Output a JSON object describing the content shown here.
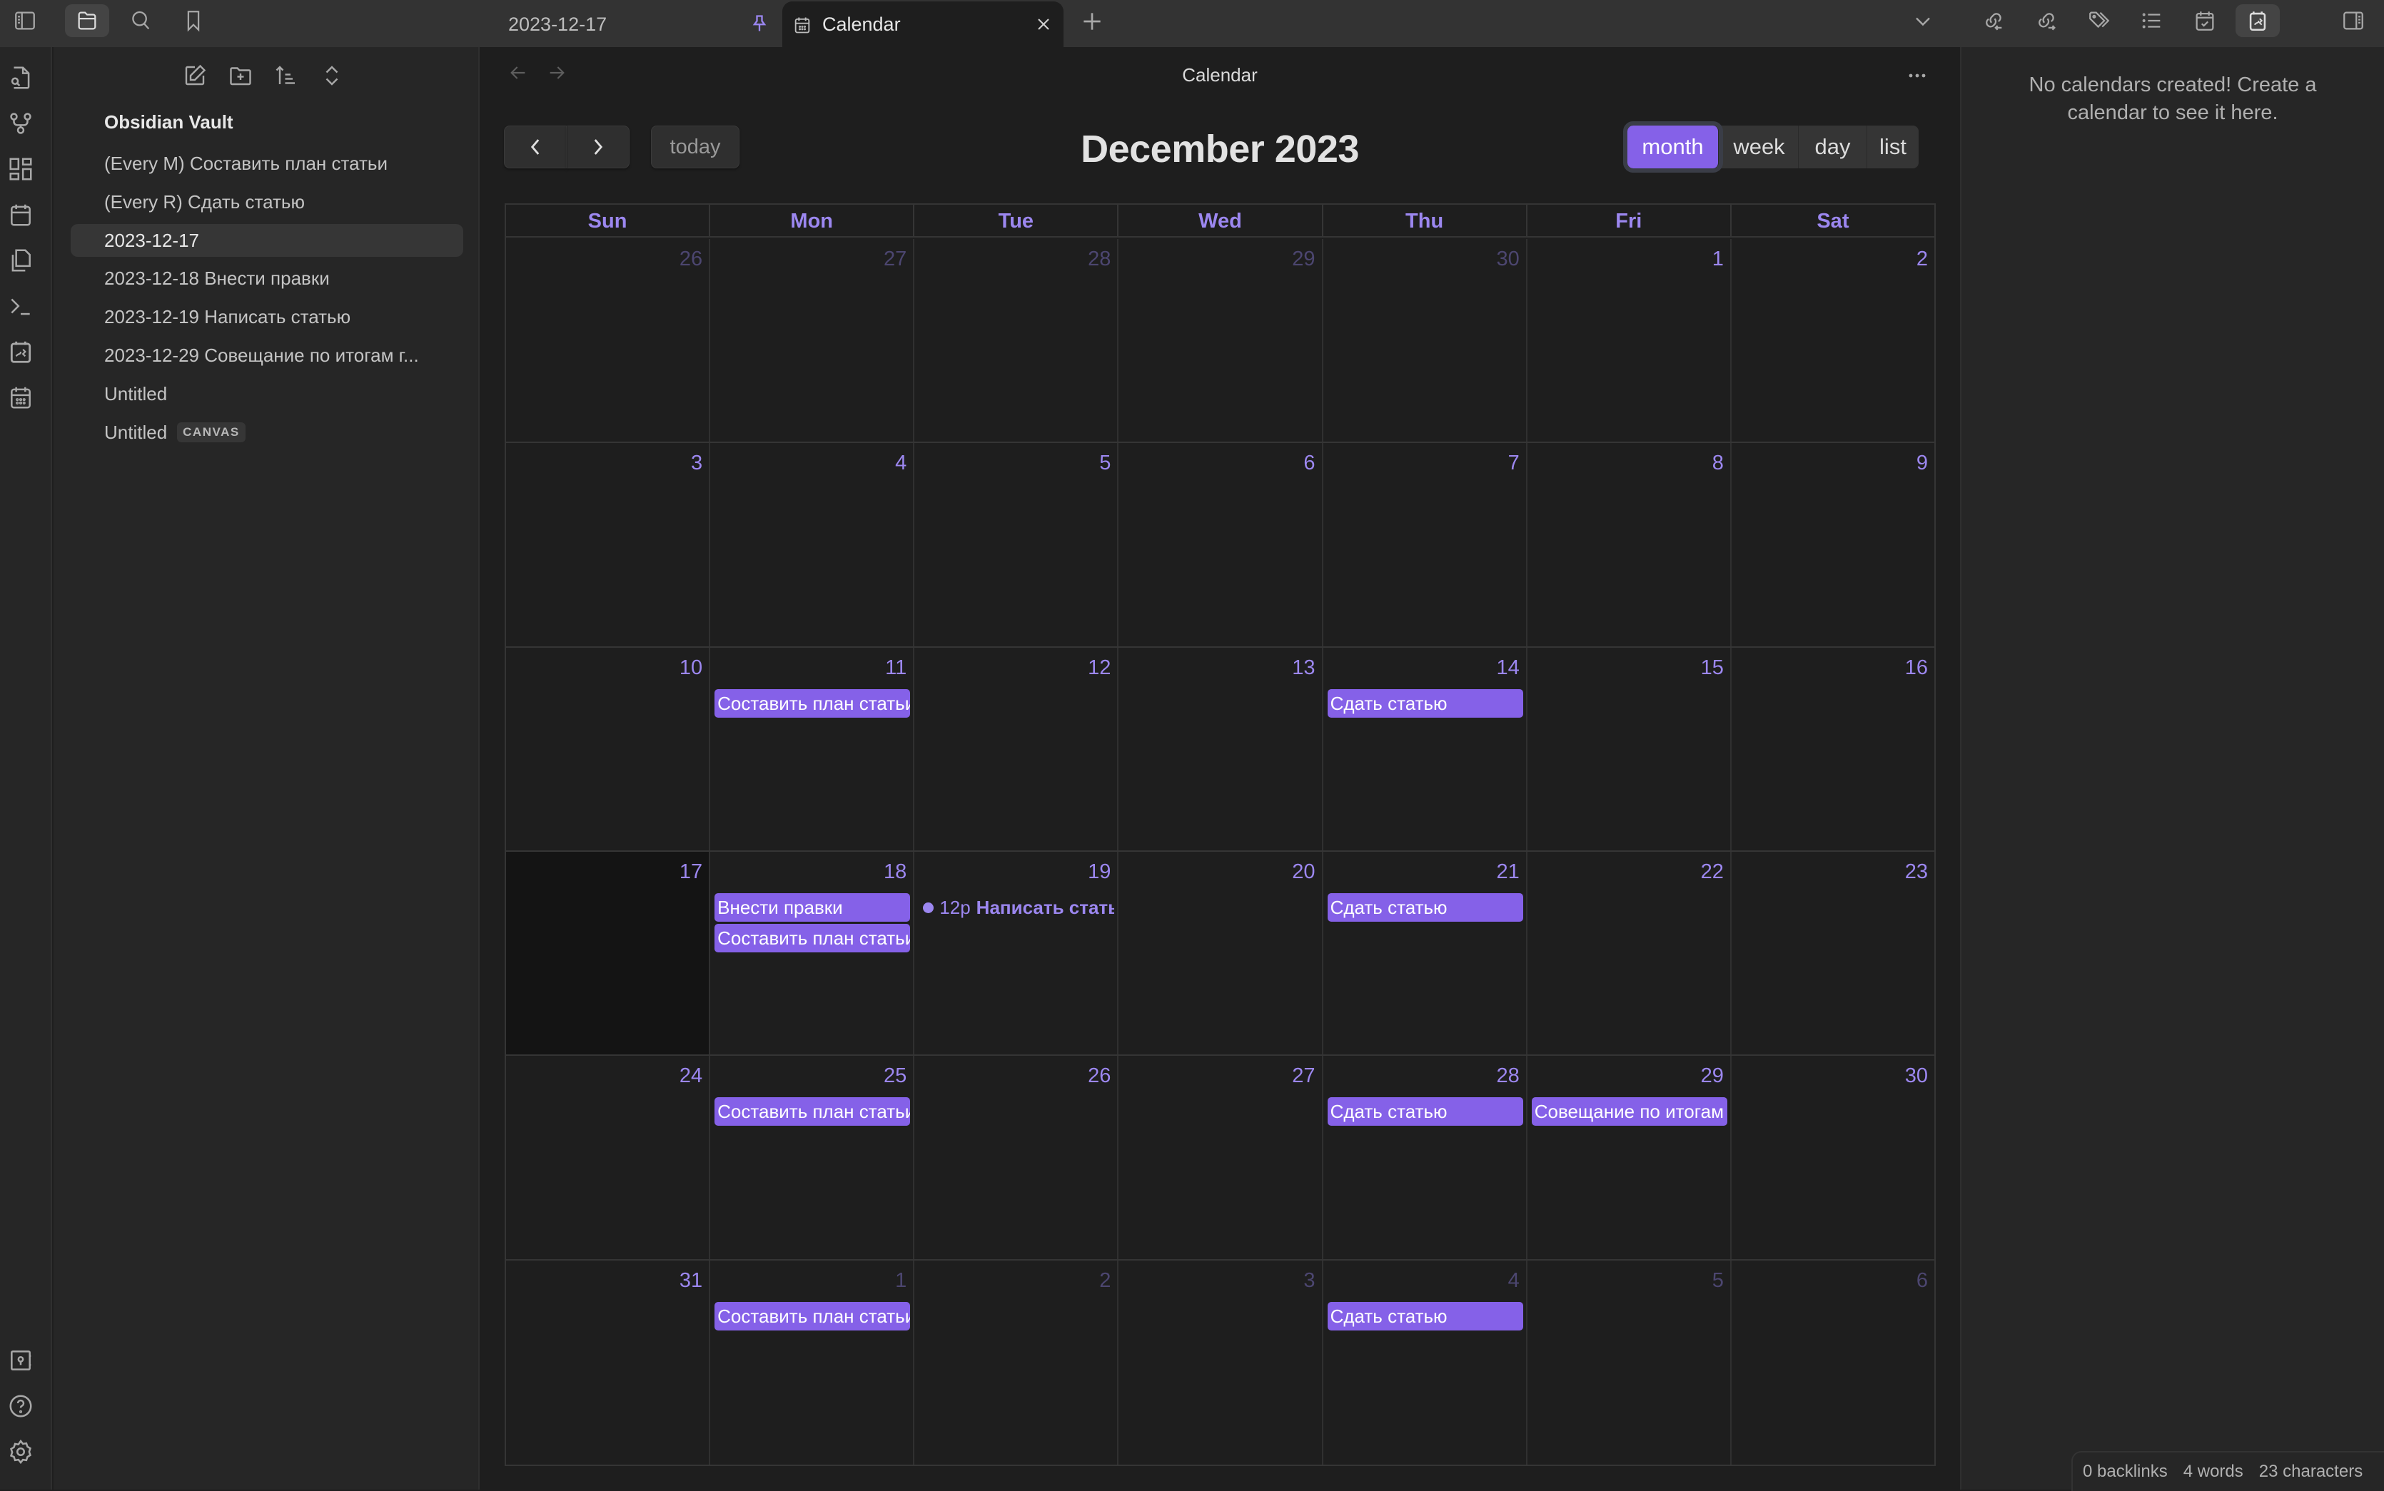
{
  "titlebar": {
    "left_icons": [
      {
        "name": "sidebar-left-toggle-icon"
      },
      {
        "name": "files-icon",
        "active": true
      },
      {
        "name": "search-icon"
      },
      {
        "name": "bookmark-icon"
      }
    ],
    "tabs": [
      {
        "title": "2023-12-17",
        "pinned": true,
        "active": false
      },
      {
        "title": "Calendar",
        "icon": "calendar-icon",
        "active": true
      }
    ],
    "right_icons": [
      {
        "name": "backlinks-icon"
      },
      {
        "name": "outgoing-links-icon"
      },
      {
        "name": "tags-icon"
      },
      {
        "name": "outline-icon"
      },
      {
        "name": "calendar-check-icon"
      },
      {
        "name": "full-calendar-icon",
        "active": true
      },
      {
        "name": "sidebar-right-toggle-icon"
      }
    ]
  },
  "ribbon": {
    "top": [
      "file-search-icon",
      "graph-icon",
      "dashboard-icon",
      "calendar-icon",
      "copy-icon",
      "terminal-icon",
      "full-calendar-icon",
      "calendar-grid-icon"
    ],
    "bottom": [
      "vault-icon",
      "help-icon",
      "settings-icon"
    ]
  },
  "explorer": {
    "vault": "Obsidian Vault",
    "files": [
      {
        "name": "(Every M) Составить план статьи"
      },
      {
        "name": "(Every R) Сдать статью"
      },
      {
        "name": "2023-12-17",
        "active": true
      },
      {
        "name": "2023-12-18 Внести правки"
      },
      {
        "name": "2023-12-19 Написать статью"
      },
      {
        "name": "2023-12-29 Совещание по итогам г..."
      },
      {
        "name": "Untitled"
      },
      {
        "name": "Untitled",
        "badge": "CANVAS"
      }
    ]
  },
  "main": {
    "view_title": "Calendar",
    "toolbar": {
      "prev": "‹",
      "next": "›",
      "today": "today",
      "title": "December 2023",
      "views": [
        {
          "label": "month",
          "active": true
        },
        {
          "label": "week"
        },
        {
          "label": "day"
        },
        {
          "label": "list"
        }
      ]
    },
    "weekdays": [
      "Sun",
      "Mon",
      "Tue",
      "Wed",
      "Thu",
      "Fri",
      "Sat"
    ],
    "weeks": [
      [
        {
          "day": "26",
          "other": true
        },
        {
          "day": "27",
          "other": true
        },
        {
          "day": "28",
          "other": true
        },
        {
          "day": "29",
          "other": true
        },
        {
          "day": "30",
          "other": true
        },
        {
          "day": "1"
        },
        {
          "day": "2"
        }
      ],
      [
        {
          "day": "3"
        },
        {
          "day": "4"
        },
        {
          "day": "5"
        },
        {
          "day": "6"
        },
        {
          "day": "7"
        },
        {
          "day": "8"
        },
        {
          "day": "9"
        }
      ],
      [
        {
          "day": "10"
        },
        {
          "day": "11",
          "events": [
            {
              "title": "Составить план статьи"
            }
          ]
        },
        {
          "day": "12"
        },
        {
          "day": "13"
        },
        {
          "day": "14",
          "events": [
            {
              "title": "Сдать статью"
            }
          ]
        },
        {
          "day": "15"
        },
        {
          "day": "16"
        }
      ],
      [
        {
          "day": "17",
          "today": true
        },
        {
          "day": "18",
          "events": [
            {
              "title": "Внести правки"
            },
            {
              "title": "Составить план статьи"
            }
          ]
        },
        {
          "day": "19",
          "events": [
            {
              "title": "Написать статью",
              "time": "12p",
              "timed": true
            }
          ]
        },
        {
          "day": "20"
        },
        {
          "day": "21",
          "events": [
            {
              "title": "Сдать статью"
            }
          ]
        },
        {
          "day": "22"
        },
        {
          "day": "23"
        }
      ],
      [
        {
          "day": "24"
        },
        {
          "day": "25",
          "events": [
            {
              "title": "Составить план статьи"
            }
          ]
        },
        {
          "day": "26"
        },
        {
          "day": "27"
        },
        {
          "day": "28",
          "events": [
            {
              "title": "Сдать статью"
            }
          ]
        },
        {
          "day": "29",
          "events": [
            {
              "title": "Совещание по итогам года"
            }
          ]
        },
        {
          "day": "30"
        }
      ],
      [
        {
          "day": "31"
        },
        {
          "day": "1",
          "other": true,
          "events": [
            {
              "title": "Составить план статьи"
            }
          ]
        },
        {
          "day": "2",
          "other": true
        },
        {
          "day": "3",
          "other": true
        },
        {
          "day": "4",
          "other": true,
          "events": [
            {
              "title": "Сдать статью"
            }
          ]
        },
        {
          "day": "5",
          "other": true
        },
        {
          "day": "6",
          "other": true
        }
      ]
    ]
  },
  "right_panel": {
    "message": "No calendars created! Create a calendar to see it here."
  },
  "status_bar": {
    "backlinks": "0 backlinks",
    "words": "4 words",
    "characters": "23 characters"
  },
  "colors": {
    "accent": "#8561e8",
    "accent_text": "#9c87f0",
    "background": "#1e1e1e",
    "sidebar": "#262626"
  }
}
